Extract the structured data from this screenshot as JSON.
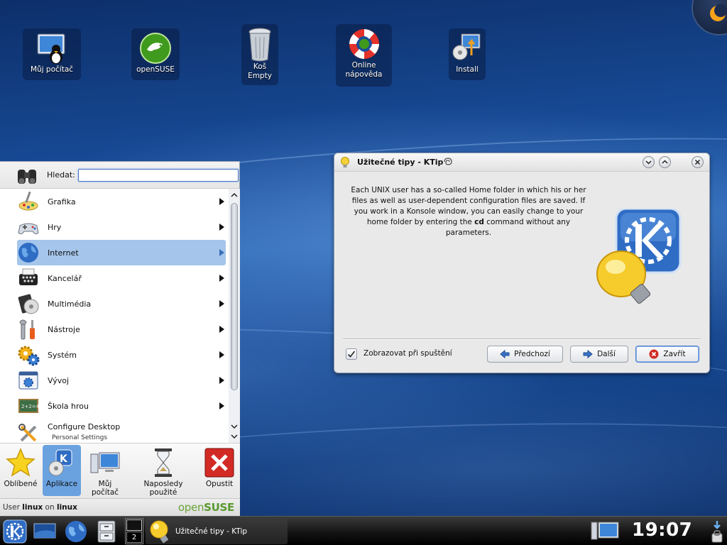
{
  "desktop_icons": [
    {
      "label": "Můj počítač",
      "icon": "computer-tux-icon"
    },
    {
      "label": "openSUSE",
      "icon": "opensuse-icon"
    },
    {
      "label": "Koš\nEmpty",
      "icon": "trash-icon"
    },
    {
      "label": "Online nápověda",
      "icon": "lifebuoy-icon"
    },
    {
      "label": "Install",
      "icon": "install-icon"
    }
  ],
  "kmenu": {
    "search_label": "Hledat:",
    "search_value": "",
    "items": [
      {
        "label": "Grafika",
        "icon": "graphics-icon"
      },
      {
        "label": "Hry",
        "icon": "gamepad-icon"
      },
      {
        "label": "Internet",
        "icon": "globe-icon"
      },
      {
        "label": "Kancelář",
        "icon": "office-icon"
      },
      {
        "label": "Multimédia",
        "icon": "multimedia-icon"
      },
      {
        "label": "Nástroje",
        "icon": "tools-icon"
      },
      {
        "label": "Systém",
        "icon": "gears-icon"
      },
      {
        "label": "Vývoj",
        "icon": "development-icon"
      },
      {
        "label": "Škola hrou",
        "icon": "chalkboard-icon"
      },
      {
        "label": "Configure Desktop",
        "sub": "Personal Settings",
        "icon": "configure-icon"
      }
    ],
    "tabs": [
      {
        "label": "Oblíbené",
        "icon": "star-icon"
      },
      {
        "label": "Aplikace",
        "icon": "applications-icon"
      },
      {
        "label": "Můj počítač",
        "icon": "computer-icon"
      },
      {
        "label": "Naposledy použité",
        "icon": "hourglass-icon"
      },
      {
        "label": "Opustit",
        "icon": "exit-icon"
      }
    ],
    "footer": {
      "user_prefix": "User",
      "user_name": "linux",
      "on": "on",
      "host": "linux",
      "brand_open": "open",
      "brand_suse": "SUSE"
    }
  },
  "ktip": {
    "title": "Užitečné tipy - KTip",
    "tip_before": "Each UNIX user has a so-called Home folder in which his or her files as well as user-dependent configuration files are saved. If you work in a Konsole window, you can easily change to your home folder by entering the ",
    "tip_bold": "cd",
    "tip_after": " command without any parameters.",
    "checkbox_label": "Zobrazovat při spuštění",
    "checkbox_checked": true,
    "btn_prev": "Předchozí",
    "btn_next": "Další",
    "btn_close": "Zavřít"
  },
  "taskbar": {
    "pager_desktop2": "2",
    "task_label": "Užitečné tipy - KTip",
    "clock": "19:07"
  }
}
